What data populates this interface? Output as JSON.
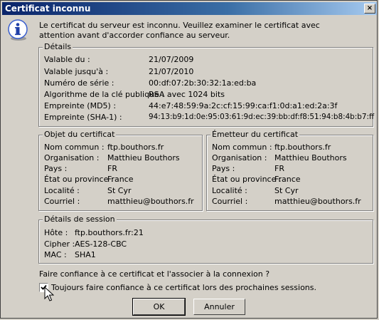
{
  "window": {
    "title": "Certificat inconnu",
    "close_glyph": "×"
  },
  "intro": "Le certificat du serveur est inconnu. Veuillez examiner le certificat avec attention avant d'accorder confiance au serveur.",
  "details": {
    "legend": "Détails",
    "rows": [
      {
        "label": "Valable du :",
        "value": "21/07/2009"
      },
      {
        "label": "Valable jusqu'à :",
        "value": "21/07/2010"
      },
      {
        "label": "Numéro de série :",
        "value": "00:df:07:2b:30:32:1a:ed:ba"
      },
      {
        "label": "Algorithme de la clé publique :",
        "value": "RSA avec 1024 bits"
      },
      {
        "label": "Empreinte (MD5) :",
        "value": "44:e7:48:59:9a:2c:cf:15:99:ca:f1:0d:a1:ed:2a:3f"
      },
      {
        "label": "Empreinte (SHA-1) :",
        "value": "94:13:b9:1d:0e:95:03:61:9d:ec:39:bb:df:f8:51:94:b8:4b:b7:ff"
      }
    ]
  },
  "subject": {
    "legend": "Objet du certificat",
    "rows": [
      {
        "label": "Nom commun :",
        "value": "ftp.bouthors.fr"
      },
      {
        "label": "Organisation :",
        "value": "Matthieu Bouthors"
      },
      {
        "label": "Pays :",
        "value": "FR"
      },
      {
        "label": "État ou province :",
        "value": "France"
      },
      {
        "label": "Localité :",
        "value": "St Cyr"
      },
      {
        "label": "Courriel :",
        "value": "matthieu@bouthors.fr"
      }
    ]
  },
  "issuer": {
    "legend": "Émetteur du certificat",
    "rows": [
      {
        "label": "Nom commun :",
        "value": "ftp.bouthors.fr"
      },
      {
        "label": "Organisation :",
        "value": "Matthieu Bouthors"
      },
      {
        "label": "Pays :",
        "value": "FR"
      },
      {
        "label": "État ou province :",
        "value": "France"
      },
      {
        "label": "Localité :",
        "value": "St Cyr"
      },
      {
        "label": "Courriel :",
        "value": "matthieu@bouthors.fr"
      }
    ]
  },
  "session": {
    "legend": "Détails de session",
    "rows": [
      {
        "label": "Hôte :",
        "value": "ftp.bouthors.fr:21"
      },
      {
        "label": "Cipher :",
        "value": "AES-128-CBC"
      },
      {
        "label": "MAC :",
        "value": "SHA1"
      }
    ]
  },
  "trust": {
    "question": "Faire confiance à ce certificat et l'associer à la connexion ?",
    "always_label": "Toujours faire confiance à ce certificat lors des prochaines sessions.",
    "always_checked": true
  },
  "buttons": {
    "ok": "OK",
    "cancel": "Annuler"
  },
  "icons": {
    "info": "info-icon",
    "cursor": "mouse-pointer-icon"
  }
}
